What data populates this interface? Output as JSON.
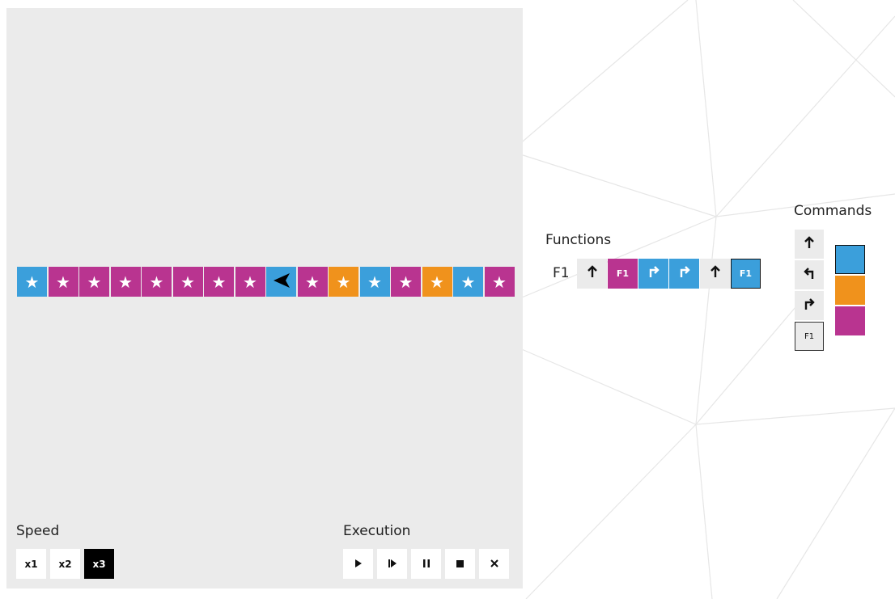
{
  "board": {
    "tiles": [
      {
        "color": "#3b9fdb",
        "icon": "star-icon",
        "glyph": "★"
      },
      {
        "color": "#b93490",
        "icon": "star-icon",
        "glyph": "★"
      },
      {
        "color": "#b93490",
        "icon": "star-icon",
        "glyph": "★"
      },
      {
        "color": "#b93490",
        "icon": "star-icon",
        "glyph": "★"
      },
      {
        "color": "#b93490",
        "icon": "star-icon",
        "glyph": "★"
      },
      {
        "color": "#b93490",
        "icon": "star-icon",
        "glyph": "★"
      },
      {
        "color": "#b93490",
        "icon": "star-icon",
        "glyph": "★"
      },
      {
        "color": "#b93490",
        "icon": "star-icon",
        "glyph": "★"
      },
      {
        "color": "#3b9fdb",
        "icon": "robot-arrow-left-icon",
        "glyph": "robot"
      },
      {
        "color": "#b93490",
        "icon": "star-icon",
        "glyph": "★"
      },
      {
        "color": "#f0921c",
        "icon": "star-icon",
        "glyph": "★"
      },
      {
        "color": "#3b9fdb",
        "icon": "star-icon",
        "glyph": "★"
      },
      {
        "color": "#b93490",
        "icon": "star-icon",
        "glyph": "★"
      },
      {
        "color": "#f0921c",
        "icon": "star-icon",
        "glyph": "★"
      },
      {
        "color": "#3b9fdb",
        "icon": "star-icon",
        "glyph": "★"
      },
      {
        "color": "#b93490",
        "icon": "star-icon",
        "glyph": "★"
      }
    ]
  },
  "speed": {
    "label": "Speed",
    "options": [
      "x1",
      "x2",
      "x3"
    ],
    "selected": "x3"
  },
  "execution": {
    "label": "Execution",
    "buttons": [
      {
        "icon": "play-icon",
        "glyph": "▶"
      },
      {
        "icon": "step-icon",
        "glyph": "⏵"
      },
      {
        "icon": "pause-icon",
        "glyph": "❚❚"
      },
      {
        "icon": "stop-icon",
        "glyph": "■"
      },
      {
        "icon": "clear-icon",
        "glyph": "✕"
      }
    ]
  },
  "functions": {
    "label": "Functions",
    "f1": {
      "name": "F1",
      "slots": [
        {
          "command": "forward",
          "glyph": "🡑",
          "icon": "arrow-up-icon",
          "color": null
        },
        {
          "command": "call-f1",
          "text": "F1",
          "icon": "function-f1-icon",
          "color": "#b93490"
        },
        {
          "command": "turn-right",
          "glyph": "↱",
          "icon": "turn-right-icon",
          "color": "#3b9fdb"
        },
        {
          "command": "turn-right",
          "glyph": "↱",
          "icon": "turn-right-icon",
          "color": "#3b9fdb"
        },
        {
          "command": "forward",
          "glyph": "🡑",
          "icon": "arrow-up-icon",
          "color": null
        },
        {
          "command": "call-f1",
          "text": "F1",
          "icon": "function-f1-icon",
          "color": "#3b9fdb",
          "selected": true
        }
      ]
    }
  },
  "commands": {
    "label": "Commands",
    "items": [
      {
        "icon": "arrow-up-icon",
        "glyph": "🡑"
      },
      {
        "icon": "turn-left-icon",
        "glyph": "↰"
      },
      {
        "icon": "turn-right-icon",
        "glyph": "↱"
      },
      {
        "icon": "function-f1-icon",
        "text": "F1"
      }
    ],
    "colors": [
      {
        "color": "#3b9fdb",
        "selected": true
      },
      {
        "color": "#f0921c",
        "selected": false
      },
      {
        "color": "#b93490",
        "selected": false
      }
    ]
  }
}
